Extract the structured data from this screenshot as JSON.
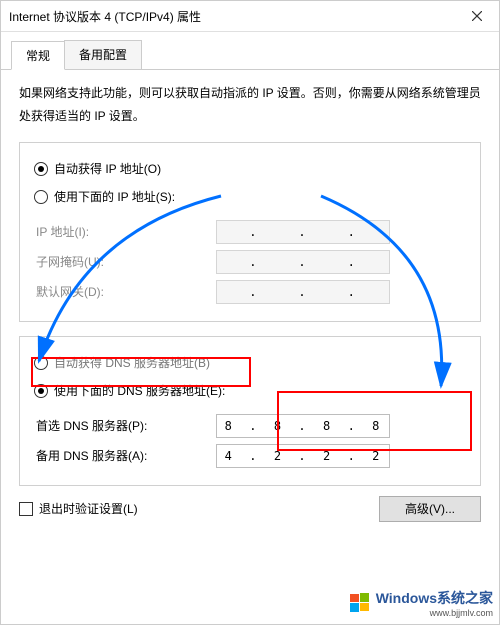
{
  "window": {
    "title": "Internet 协议版本 4 (TCP/IPv4) 属性"
  },
  "tabs": {
    "general": "常规",
    "alternate": "备用配置"
  },
  "intro": "如果网络支持此功能，则可以获取自动指派的 IP 设置。否则，你需要从网络系统管理员处获得适当的 IP 设置。",
  "ip": {
    "auto": "自动获得 IP 地址(O)",
    "manual": "使用下面的 IP 地址(S):",
    "ip_label": "IP 地址(I):",
    "mask_label": "子网掩码(U):",
    "gw_label": "默认网关(D):"
  },
  "dns": {
    "auto": "自动获得 DNS 服务器地址(B)",
    "manual": "使用下面的 DNS 服务器地址(E):",
    "pref_label": "首选 DNS 服务器(P):",
    "alt_label": "备用 DNS 服务器(A):",
    "pref": [
      "8",
      "8",
      "8",
      "8"
    ],
    "alt": [
      "4",
      "2",
      "2",
      "2"
    ]
  },
  "validate": "退出时验证设置(L)",
  "advanced": "高级(V)...",
  "watermark": {
    "text": "Windows系统之家",
    "url": "www.bjjmlv.com"
  },
  "highlight_color": "#ff0000",
  "arrow_color": "#0070ff"
}
